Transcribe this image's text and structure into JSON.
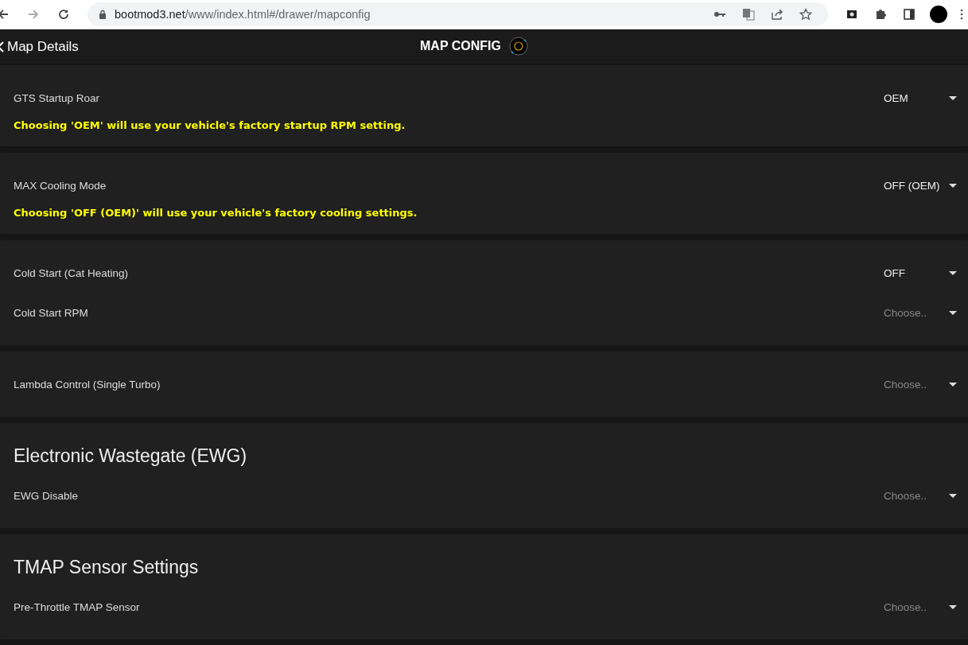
{
  "browser": {
    "url_host": "bootmod3.net",
    "url_path": "/www/index.html#/drawer/mapconfig"
  },
  "header": {
    "back_label": "Map Details",
    "title": "MAP CONFIG"
  },
  "cards": [
    {
      "settings": [
        {
          "label": "GTS Startup Roar",
          "value": "OEM",
          "note": "Choosing 'OEM' will use your vehicle's factory startup RPM setting."
        }
      ]
    },
    {
      "settings": [
        {
          "label": "MAX Cooling Mode",
          "value": "OFF (OEM)",
          "note": "Choosing 'OFF (OEM)' will use your vehicle's factory cooling settings."
        }
      ]
    },
    {
      "settings": [
        {
          "label": "Cold Start (Cat Heating)",
          "value": "OFF"
        },
        {
          "label": "Cold Start RPM",
          "placeholder": "Choose.."
        }
      ]
    },
    {
      "settings": [
        {
          "label": "Lambda Control (Single Turbo)",
          "placeholder": "Choose.."
        }
      ]
    },
    {
      "heading": "Electronic Wastegate (EWG)",
      "settings": [
        {
          "label": "EWG Disable",
          "placeholder": "Choose.."
        }
      ]
    },
    {
      "heading": "TMAP Sensor Settings",
      "settings": [
        {
          "label": "Pre-Throttle TMAP Sensor",
          "placeholder": "Choose.."
        }
      ]
    }
  ]
}
